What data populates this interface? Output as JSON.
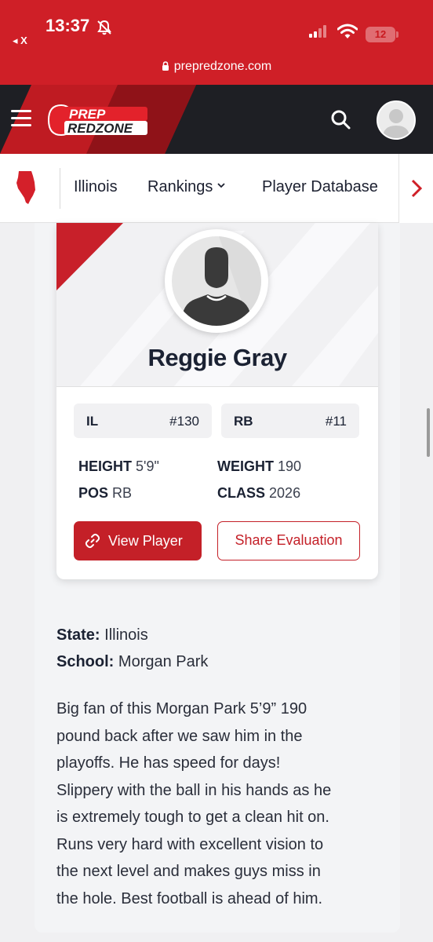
{
  "status_bar": {
    "time": "13:37",
    "back_label": "◂ X",
    "battery": "12"
  },
  "browser": {
    "url": "prepredzone.com"
  },
  "header": {
    "logo_top": "PREP",
    "logo_bottom": "REDZONE",
    "brand_color": "#cf1f27"
  },
  "subnav": {
    "items": [
      {
        "label": "Illinois"
      },
      {
        "label": "Rankings"
      },
      {
        "label": "Player Database"
      }
    ]
  },
  "player": {
    "name": "Reggie Gray",
    "rankings": [
      {
        "label": "IL",
        "value": "#130"
      },
      {
        "label": "RB",
        "value": "#11"
      }
    ],
    "stats": {
      "height_label": "HEIGHT",
      "height": "5'9\"",
      "weight_label": "WEIGHT",
      "weight": "190",
      "pos_label": "POS",
      "pos": "RB",
      "class_label": "CLASS",
      "class": "2026"
    },
    "view_button": "View Player",
    "share_button": "Share Evaluation"
  },
  "details": {
    "state_label": "State:",
    "state": "Illinois",
    "school_label": "School:",
    "school": "Morgan Park"
  },
  "evaluation": {
    "lines": [
      "Big fan of this Morgan Park  5’9” 190",
      "pound back after we saw him in the",
      "playoffs.  He has speed for days!",
      "Slippery with the ball in his hands as he",
      "is extremely tough to get a clean hit on.",
      "Runs very hard with excellent vision to",
      "the next level and makes guys miss in",
      "the hole. Best football is ahead of him."
    ]
  }
}
